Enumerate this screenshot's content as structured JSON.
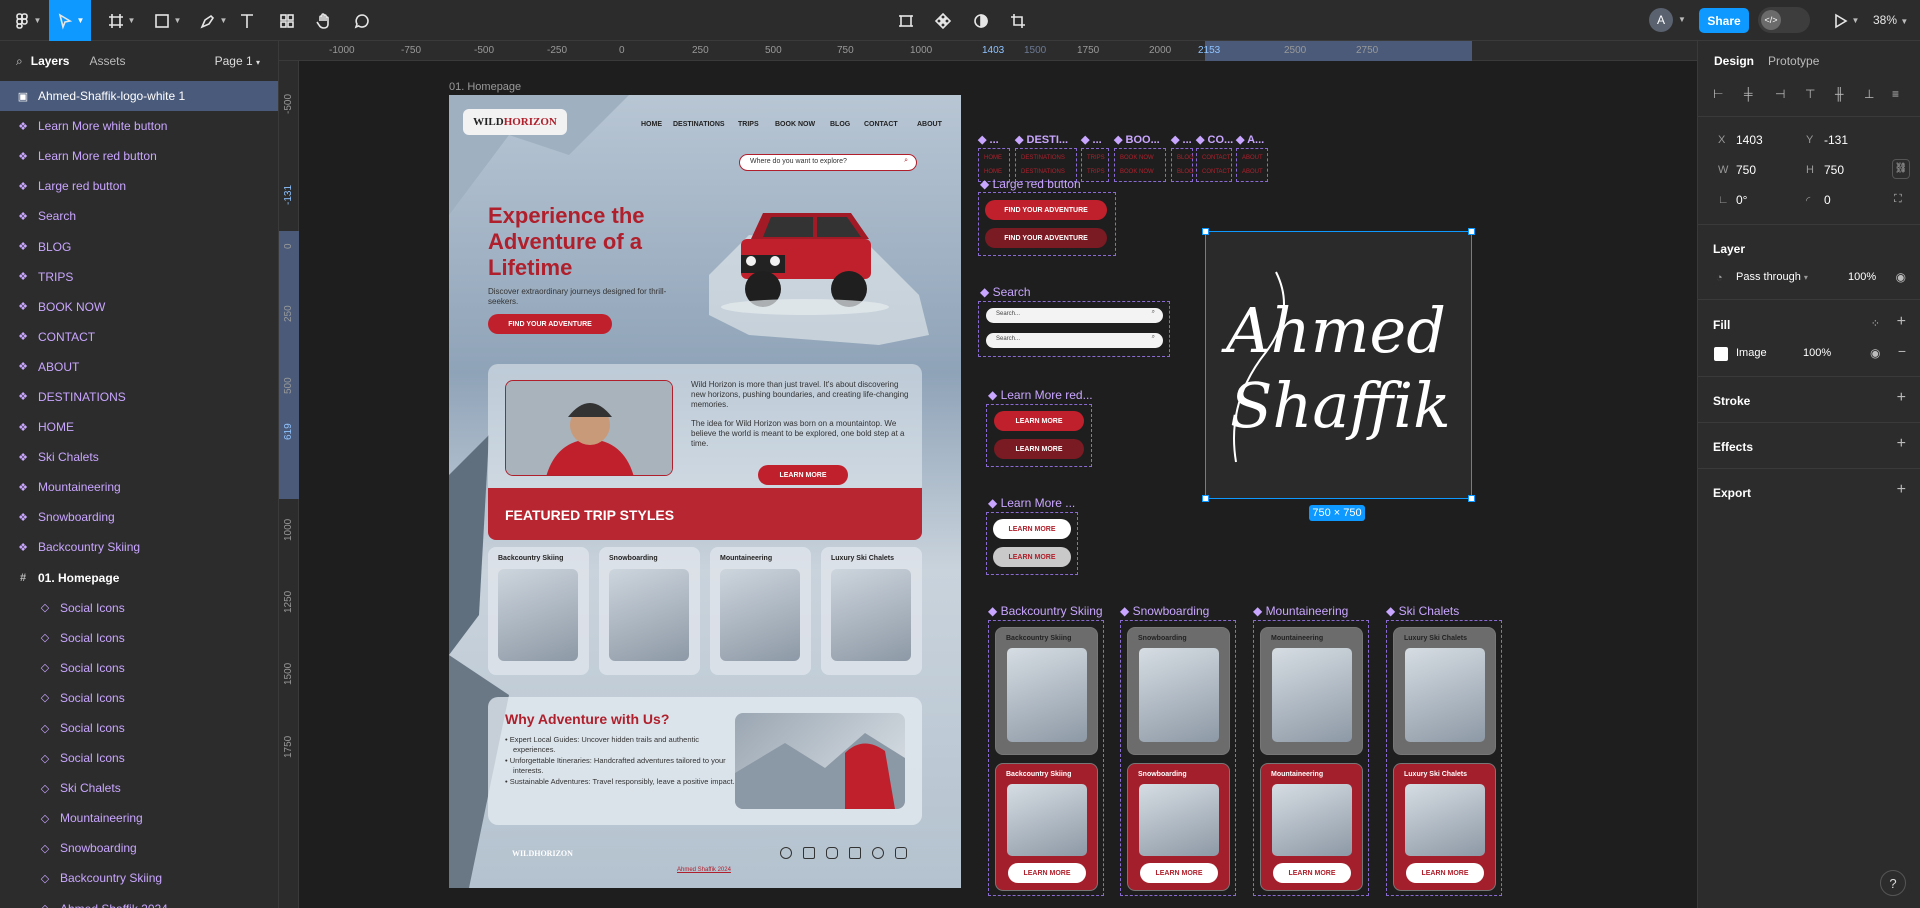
{
  "toolbar": {
    "zoom": "38%",
    "share_label": "Share",
    "avatar_initial": "A",
    "dev_label": "</>"
  },
  "left_panel": {
    "tabs": {
      "layers": "Layers",
      "assets": "Assets"
    },
    "page_selector": "Page 1",
    "layers": [
      {
        "name": "Ahmed-Shaffik-logo-white 1",
        "kind": "image",
        "selected": true
      },
      {
        "name": "Learn More white button",
        "kind": "component"
      },
      {
        "name": "Learn More red button",
        "kind": "component"
      },
      {
        "name": "Large red button",
        "kind": "component"
      },
      {
        "name": "Search",
        "kind": "component"
      },
      {
        "name": "BLOG",
        "kind": "component"
      },
      {
        "name": "TRIPS",
        "kind": "component"
      },
      {
        "name": "BOOK NOW",
        "kind": "component"
      },
      {
        "name": "CONTACT",
        "kind": "component"
      },
      {
        "name": "ABOUT",
        "kind": "component"
      },
      {
        "name": "DESTINATIONS",
        "kind": "component"
      },
      {
        "name": "HOME",
        "kind": "component"
      },
      {
        "name": "Ski Chalets",
        "kind": "component"
      },
      {
        "name": "Mountaineering",
        "kind": "component"
      },
      {
        "name": "Snowboarding",
        "kind": "component"
      },
      {
        "name": "Backcountry Skiing",
        "kind": "component"
      },
      {
        "name": "01. Homepage",
        "kind": "frame"
      },
      {
        "name": "Social Icons",
        "kind": "instance"
      },
      {
        "name": "Social Icons",
        "kind": "instance"
      },
      {
        "name": "Social Icons",
        "kind": "instance"
      },
      {
        "name": "Social Icons",
        "kind": "instance"
      },
      {
        "name": "Social Icons",
        "kind": "instance"
      },
      {
        "name": "Social Icons",
        "kind": "instance"
      },
      {
        "name": "Ski Chalets",
        "kind": "instance"
      },
      {
        "name": "Mountaineering",
        "kind": "instance"
      },
      {
        "name": "Snowboarding",
        "kind": "instance"
      },
      {
        "name": "Backcountry Skiing",
        "kind": "instance"
      },
      {
        "name": "Ahmed Shaffik 2024",
        "kind": "instance"
      }
    ]
  },
  "rulers": {
    "h": [
      "-1000",
      "-750",
      "-500",
      "-250",
      "0",
      "250",
      "500",
      "750",
      "1000",
      "1403",
      "1500",
      "1750",
      "2000",
      "2153",
      "2500",
      "2750"
    ],
    "v": [
      "-500",
      "-131",
      "0",
      "250",
      "500",
      "619",
      "1000",
      "1250",
      "1500",
      "1750"
    ]
  },
  "canvas": {
    "frame_label": "01. Homepage",
    "homepage": {
      "logo_prefix": "WILD",
      "logo_suffix": "HORIZON",
      "nav": [
        "HOME",
        "DESTINATIONS",
        "TRIPS",
        "BOOK NOW",
        "BLOG",
        "CONTACT",
        "ABOUT"
      ],
      "search_placeholder": "Where do you want to explore?",
      "hero_title": "Experience the Adventure of a Lifetime",
      "hero_sub": "Discover extraordinary journeys designed for thrill-seekers.",
      "hero_cta": "FIND YOUR ADVENTURE",
      "about_p1": "Wild Horizon is more than just travel. It's about discovering new horizons, pushing boundaries, and creating life-changing memories.",
      "about_p2": "The idea for Wild Horizon was born on a mountaintop. We believe the world is meant to be explored, one bold step at a time.",
      "about_cta": "LEARN MORE",
      "featured_title": "FEATURED TRIP STYLES",
      "cards": [
        "Backcountry Skiing",
        "Snowboarding",
        "Mountaineering",
        "Luxury Ski Chalets"
      ],
      "why_title": "Why Adventure with Us?",
      "why_points": [
        "Expert Local Guides: Uncover hidden trails and authentic experiences.",
        "Unforgettable Itineraries: Handcrafted adventures tailored to your interests.",
        "Sustainable Adventures: Travel responsibly, leave a positive impact."
      ],
      "footer_logo": "WILDHORIZON",
      "footer_copy": "Ahmed Shaffik 2024"
    },
    "nav_components": [
      {
        "label": "...",
        "items": [
          "HOME",
          "HOME"
        ]
      },
      {
        "label": "DESTI...",
        "items": [
          "DESTINATIONS",
          "DESTINATIONS"
        ]
      },
      {
        "label": "...",
        "items": [
          "TRIPS",
          "TRIPS"
        ]
      },
      {
        "label": "BOO...",
        "items": [
          "BOOK NOW",
          "BOOK NOW"
        ]
      },
      {
        "label": "...",
        "items": [
          "BLOG",
          "BLOG"
        ]
      },
      {
        "label": "CO...",
        "items": [
          "CONTACT",
          "CONTACT"
        ]
      },
      {
        "label": "A...",
        "items": [
          "ABOUT",
          "ABOUT"
        ]
      }
    ],
    "large_red_button": {
      "label": "Large red button",
      "btn": "FIND YOUR ADVENTURE"
    },
    "search_comp": {
      "label": "Search",
      "placeholder": "Search..."
    },
    "learn_red": {
      "label": "Learn More red...",
      "btn": "LEARN MORE"
    },
    "learn_white": {
      "label": "Learn More ...",
      "btn": "LEARN MORE"
    },
    "trip_components": [
      {
        "label": "Backcountry Skiing",
        "title": "Backcountry Skiing"
      },
      {
        "label": "Snowboarding",
        "title": "Snowboarding"
      },
      {
        "label": "Mountaineering",
        "title": "Mountaineering"
      },
      {
        "label": "Ski Chalets",
        "title": "Luxury Ski Chalets"
      }
    ],
    "card_cta": "LEARN MORE",
    "signature": {
      "line1": "Ahmed",
      "line2": "Shaffik",
      "size_badge": "750 × 750"
    }
  },
  "right_panel": {
    "tabs": {
      "design": "Design",
      "prototype": "Prototype"
    },
    "x_label": "X",
    "x": "1403",
    "y_label": "Y",
    "y": "-131",
    "w_label": "W",
    "w": "750",
    "h_label": "H",
    "h": "750",
    "rotation": "0°",
    "radius": "0",
    "layer_title": "Layer",
    "blend": "Pass through",
    "opacity": "100%",
    "fill_title": "Fill",
    "fill_type": "Image",
    "fill_opacity": "100%",
    "stroke_title": "Stroke",
    "effects_title": "Effects",
    "export_title": "Export"
  },
  "colors": {
    "accent": "#0d99ff",
    "brand_red": "#b0202c",
    "component_purple": "#c9a6ff"
  }
}
